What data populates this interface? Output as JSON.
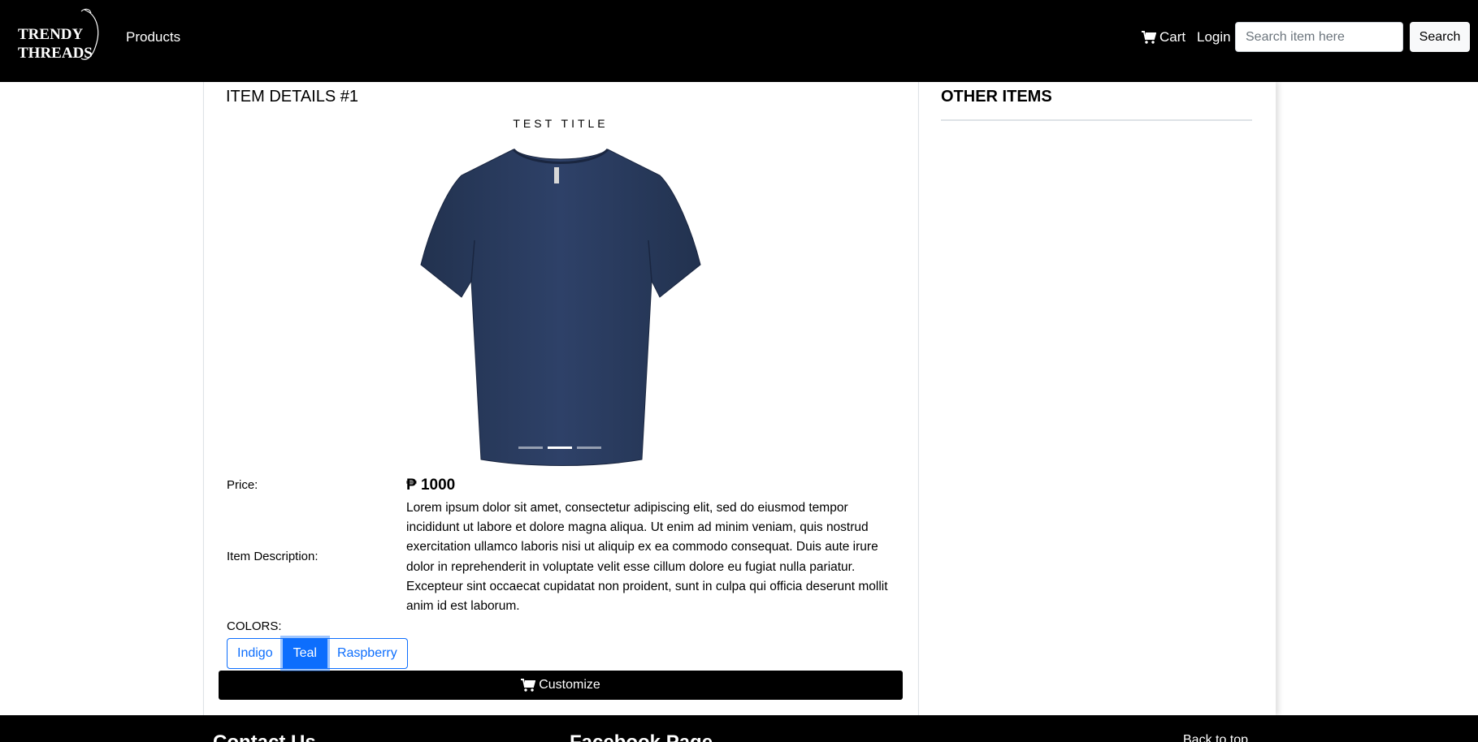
{
  "navbar": {
    "logo_text": "TRENDY THREADS",
    "products_label": "Products",
    "cart_label": "Cart",
    "login_label": "Login",
    "search_placeholder": "Search item here",
    "search_button": "Search",
    "cart_icon": "cart-icon"
  },
  "item": {
    "title": "ITEM DETAILS #1",
    "carousel_caption": "TEST TITLE",
    "carousel_slides": 3,
    "carousel_active_index": 1,
    "price_label": "Price:",
    "price_value": "₱ 1000",
    "description_label": "Item Description:",
    "description": "Lorem ipsum dolor sit amet, consectetur adipiscing elit, sed do eiusmod tempor incididunt ut labore et dolore magna aliqua. Ut enim ad minim veniam, quis nostrud exercitation ullamco laboris nisi ut aliquip ex ea commodo consequat. Duis aute irure dolor in reprehenderit in voluptate velit esse cillum dolore eu fugiat nulla pariatur. Excepteur sint occaecat cupidatat non proident, sunt in culpa qui officia deserunt mollit anim id est laborum.",
    "colors_label": "COLORS:",
    "colors": [
      "Indigo",
      "Teal",
      "Raspberry"
    ],
    "selected_color": "Teal",
    "customize_label": "Customize",
    "shirt_color": "#2c3e62"
  },
  "sidebar": {
    "title": "OTHER ITEMS"
  },
  "footer": {
    "contact_label": "Contact Us",
    "facebook_label": "Facebook Page",
    "back_to_top": "Back to top"
  },
  "colors": {
    "accent": "#0d6efd",
    "nav_bg": "#000000"
  }
}
